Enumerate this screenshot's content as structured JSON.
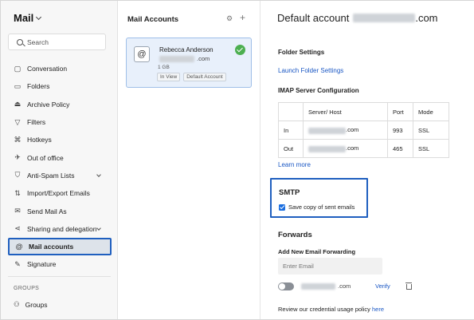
{
  "app": {
    "title": "Mail"
  },
  "search": {
    "placeholder": "Search"
  },
  "sidebar": {
    "items": [
      {
        "label": "Conversation",
        "icon": "conversation-icon"
      },
      {
        "label": "Folders",
        "icon": "folder-icon"
      },
      {
        "label": "Archive Policy",
        "icon": "archive-icon"
      },
      {
        "label": "Filters",
        "icon": "filter-icon"
      },
      {
        "label": "Hotkeys",
        "icon": "command-icon"
      },
      {
        "label": "Out of office",
        "icon": "out-of-office-icon"
      },
      {
        "label": "Anti-Spam Lists",
        "icon": "shield-icon"
      },
      {
        "label": "Import/Export Emails",
        "icon": "import-export-icon"
      },
      {
        "label": "Send Mail As",
        "icon": "send-mail-icon"
      },
      {
        "label": "Sharing and delegation",
        "icon": "share-icon"
      },
      {
        "label": "Mail accounts",
        "icon": "at-icon"
      },
      {
        "label": "Signature",
        "icon": "signature-icon"
      }
    ],
    "groups_heading": "GROUPS",
    "groups_item": "Groups"
  },
  "mail_accounts": {
    "title": "Mail Accounts",
    "account": {
      "name": "Rebecca Anderson",
      "email_tld": ".com",
      "size": "1 GB",
      "badge_view": "In View",
      "badge_default": "Default Account"
    }
  },
  "detail": {
    "title_prefix": "Default account",
    "title_suffix": ".com",
    "folder_settings": "Folder Settings",
    "launch_folder_settings": "Launch Folder Settings",
    "imap_heading": "IMAP Server Configuration",
    "table": {
      "headers": [
        "",
        "Server/ Host",
        "Port",
        "Mode"
      ],
      "rows": [
        {
          "label": "In",
          "host_tld": ".com",
          "port": "993",
          "mode": "SSL"
        },
        {
          "label": "Out",
          "host_tld": ".com",
          "port": "465",
          "mode": "SSL"
        }
      ]
    },
    "learn_more": "Learn more",
    "smtp_title": "SMTP",
    "smtp_checkbox": "Save copy of sent emails",
    "forwards_title": "Forwards",
    "add_forwarding": "Add New Email Forwarding",
    "email_placeholder": "Enter Email",
    "forward_email_tld": ".com",
    "verify": "Verify",
    "policy_text": "Review our credential usage policy",
    "policy_link": "here"
  }
}
